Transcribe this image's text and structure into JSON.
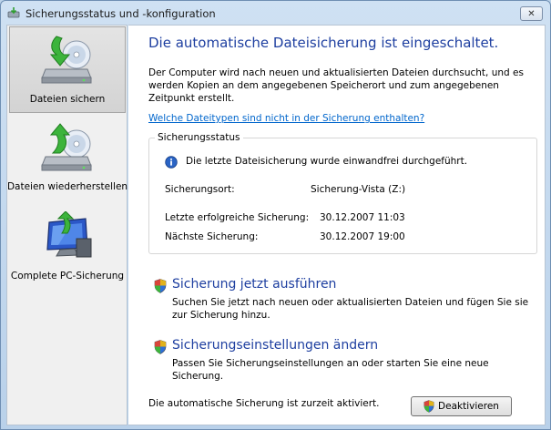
{
  "window": {
    "title": "Sicherungsstatus und -konfiguration",
    "close_label": "✕"
  },
  "sidebar": {
    "items": [
      {
        "label": "Dateien sichern",
        "icon": "backup-disk-icon",
        "active": true
      },
      {
        "label": "Dateien wiederherstellen",
        "icon": "restore-disk-icon",
        "active": false
      },
      {
        "label": "Complete PC-Sicherung",
        "icon": "complete-pc-icon",
        "active": false
      }
    ]
  },
  "main": {
    "heading": "Die automatische Dateisicherung ist eingeschaltet.",
    "description": "Der Computer wird nach neuen und aktualisierten Dateien durchsucht, und es werden Kopien an dem angegebenen Speicherort und zum angegebenen Zeitpunkt erstellt.",
    "link": "Welche Dateitypen sind nicht in der Sicherung enthalten?",
    "status": {
      "group_label": "Sicherungsstatus",
      "info_text": "Die letzte Dateisicherung wurde einwandfrei durchgeführt.",
      "location_label": "Sicherungsort:",
      "location_value": "Sicherung-Vista (Z:)",
      "last_label": "Letzte erfolgreiche Sicherung:",
      "last_value": "30.12.2007 11:03",
      "next_label": "Nächste Sicherung:",
      "next_value": "30.12.2007 19:00"
    },
    "actions": [
      {
        "title": "Sicherung jetzt ausführen",
        "description": "Suchen Sie jetzt nach neuen oder aktualisierten Dateien und fügen Sie sie zur Sicherung hinzu."
      },
      {
        "title": "Sicherungseinstellungen ändern",
        "description": "Passen Sie Sicherungseinstellungen an oder starten Sie eine neue Sicherung."
      }
    ],
    "footer_text": "Die automatische Sicherung ist zurzeit aktiviert.",
    "deactivate_label": "Deaktivieren"
  },
  "colors": {
    "heading_blue": "#1e3fa0",
    "link_blue": "#0066cc",
    "info_blue": "#2a64c5",
    "arrow_green": "#3cb43c"
  }
}
